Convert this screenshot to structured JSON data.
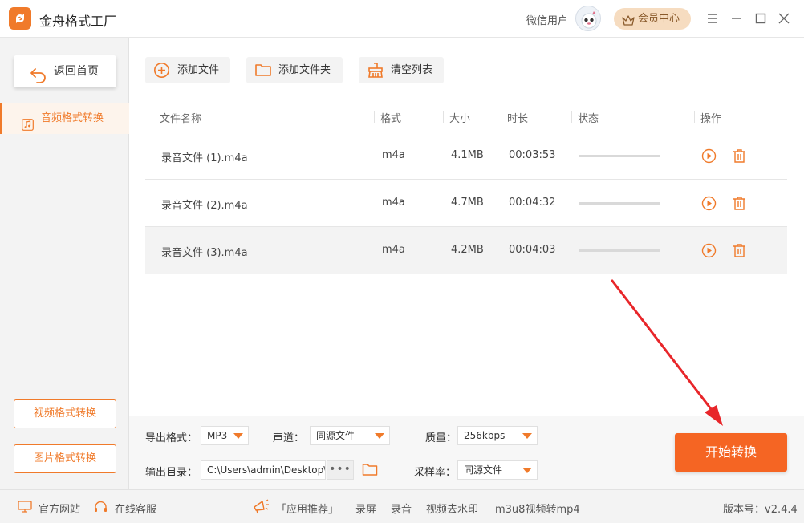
{
  "app": {
    "title": "金舟格式工厂"
  },
  "header": {
    "user_name": "微信用户",
    "member_label": "会员中心"
  },
  "sidebar": {
    "back_label": "返回首页",
    "active_item": "音频格式转换",
    "video_label": "视频格式转换",
    "image_label": "图片格式转换"
  },
  "toolbar": {
    "add_file": "添加文件",
    "add_folder": "添加文件夹",
    "clear_list": "清空列表"
  },
  "table": {
    "columns": {
      "name": "文件名称",
      "format": "格式",
      "size": "大小",
      "duration": "时长",
      "status": "状态",
      "actions": "操作"
    },
    "rows": [
      {
        "name": "录音文件 (1).m4a",
        "format": "m4a",
        "size": "4.1MB",
        "duration": "00:03:53",
        "progress": 0
      },
      {
        "name": "录音文件 (2).m4a",
        "format": "m4a",
        "size": "4.7MB",
        "duration": "00:04:32",
        "progress": 0
      },
      {
        "name": "录音文件 (3).m4a",
        "format": "m4a",
        "size": "4.2MB",
        "duration": "00:04:03",
        "progress": 0
      }
    ]
  },
  "settings": {
    "format_label": "导出格式：",
    "format_value": "MP3",
    "channel_label": "声道：",
    "channel_value": "同源文件",
    "quality_label": "质量：",
    "quality_value": "256kbps",
    "output_label": "输出目录：",
    "output_value": "C:\\Users\\admin\\Desktop\\",
    "sample_label": "采样率：",
    "sample_value": "同源文件",
    "dots": "•••",
    "start_label": "开始转换"
  },
  "footer": {
    "website": "官方网站",
    "service": "在线客服",
    "recommend": "「应用推荐」",
    "screen_record": "录屏",
    "audio_record": "录音",
    "watermark": "视频去水印",
    "m3u8": "m3u8视频转mp4",
    "version": "版本号：v2.4.4"
  },
  "colors": {
    "accent": "#f07a2a",
    "start": "#f56523",
    "member_bg": "#f6dcc0",
    "annotation": "#e8262a"
  }
}
